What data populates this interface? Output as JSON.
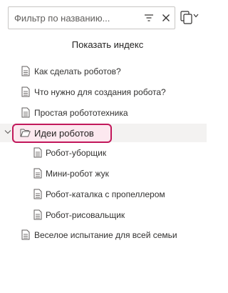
{
  "search": {
    "placeholder": "Фильтр по названию..."
  },
  "index_button": "Показать индекс",
  "tree": {
    "items": [
      {
        "label": "Как сделать роботов?",
        "level": 0,
        "type": "page"
      },
      {
        "label": "Что нужно для создания робота?",
        "level": 0,
        "type": "page"
      },
      {
        "label": "Простая робототехника",
        "level": 0,
        "type": "page"
      },
      {
        "label": "Идеи роботов",
        "level": 0,
        "type": "folder",
        "expanded": true,
        "selected": true
      },
      {
        "label": "Робот-уборщик",
        "level": 1,
        "type": "page"
      },
      {
        "label": "Мини-робот жук",
        "level": 1,
        "type": "page"
      },
      {
        "label": "Робот-каталка с пропеллером",
        "level": 1,
        "type": "page"
      },
      {
        "label": "Робот-рисовальщик",
        "level": 1,
        "type": "page"
      },
      {
        "label": "Веселое испытание для всей семьи",
        "level": 0,
        "type": "page"
      }
    ]
  },
  "colors": {
    "selection_border": "#c2185b",
    "selection_fill": "#fce8ef",
    "selected_row": "#f3f2f1"
  }
}
